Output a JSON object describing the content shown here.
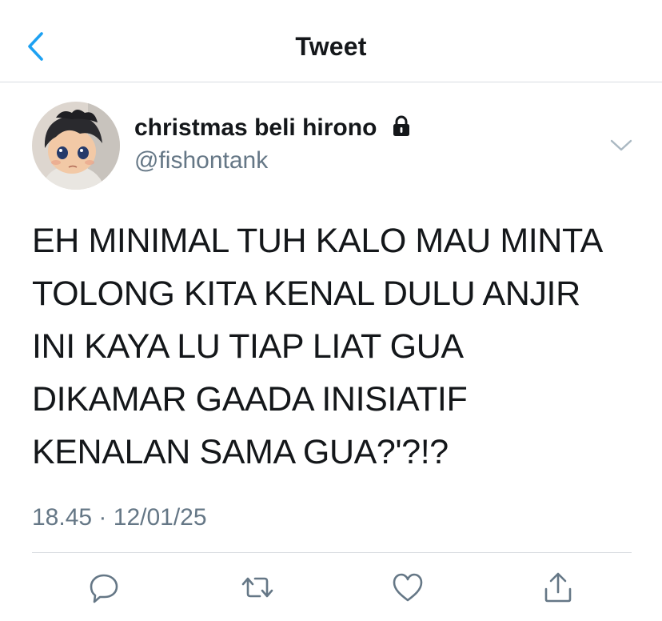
{
  "header": {
    "title": "Tweet",
    "back_icon": "chevron-left-icon",
    "accent_color": "#1da1f2"
  },
  "tweet": {
    "author": {
      "display_name": "christmas beli hirono",
      "handle": "@fishontank",
      "protected": true
    },
    "text_lines": [
      "EH MINIMAL TUH KALO MAU MINTA",
      "TOLONG KITA KENAL DULU ANJIR",
      "INI KAYA LU TIAP LIAT GUA",
      "DIKAMAR GAADA INISIATIF",
      "KENALAN SAMA GUA?'?!?"
    ],
    "time": "18.45",
    "separator": "·",
    "date": "12/01/25"
  },
  "actions": [
    {
      "name": "reply",
      "icon": "reply-icon"
    },
    {
      "name": "retweet",
      "icon": "retweet-icon"
    },
    {
      "name": "like",
      "icon": "heart-icon"
    },
    {
      "name": "share",
      "icon": "share-icon"
    }
  ],
  "colors": {
    "text": "#14171a",
    "secondary": "#657786",
    "divider": "#d9dde1"
  }
}
